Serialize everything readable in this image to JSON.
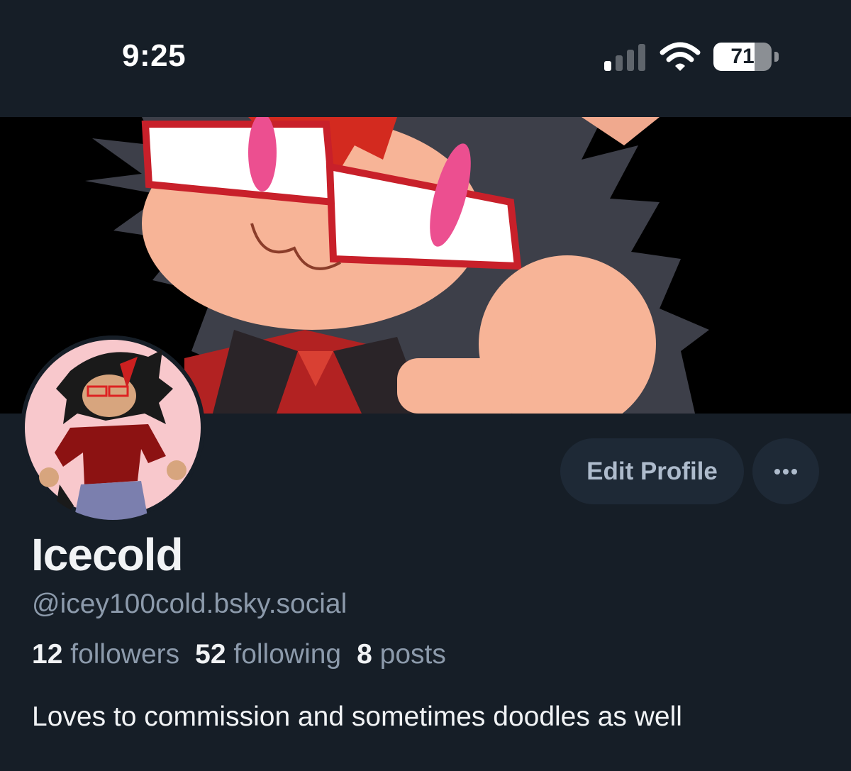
{
  "status_bar": {
    "time": "9:25",
    "battery_level": "71",
    "battery_fraction": 0.71,
    "signal_bars_active": 1,
    "signal_bars_total": 4
  },
  "profile": {
    "banner_icon": "cartoon-cat-character-banner",
    "avatar_icon": "cartoon-character-avatar",
    "edit_button_label": "Edit Profile",
    "more_icon": "ellipsis-icon",
    "display_name": "Icecold",
    "handle": "@icey100cold.bsky.social",
    "stats": {
      "followers_count": "12",
      "followers_label": "followers",
      "following_count": "52",
      "following_label": "following",
      "posts_count": "8",
      "posts_label": "posts"
    },
    "bio": "Loves to commission and sometimes doodles as well"
  },
  "colors": {
    "background": "#161e27",
    "button_bg": "#1e2936",
    "button_text": "#aebbcc",
    "secondary_text": "#8c9aab",
    "primary_text": "#f1f3f5"
  }
}
